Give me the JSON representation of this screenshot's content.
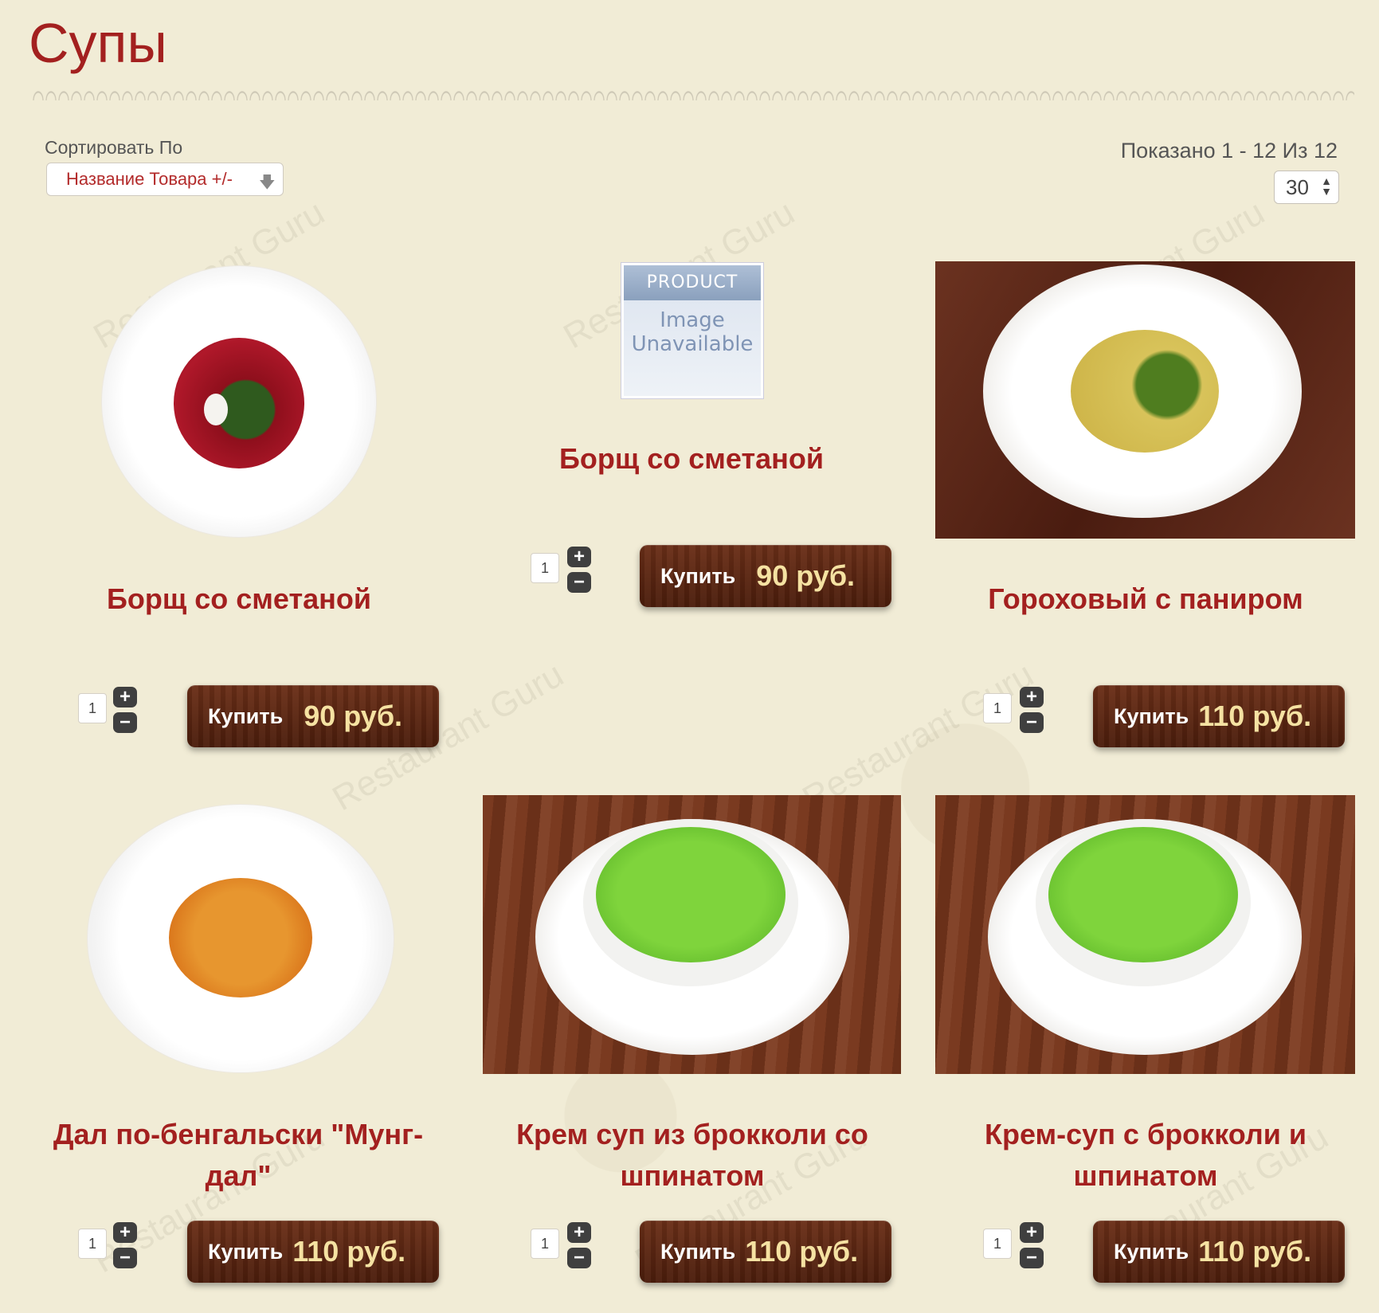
{
  "page": {
    "title": "Супы"
  },
  "toolbar": {
    "sort_label": "Сортировать По",
    "sort_value": "Название Товара +/-",
    "shown_text": "Показано 1 - 12 Из 12",
    "per_page": "30"
  },
  "products": [
    {
      "name": "Борщ со сметаной",
      "qty": "1",
      "buy_label": "Купить",
      "price": "90 руб.",
      "image": "plate-borscht"
    },
    {
      "name": "Борщ со сметаной",
      "qty": "1",
      "buy_label": "Купить",
      "price": "90 руб.",
      "image": "placeholder"
    },
    {
      "name": "Гороховый с паниром",
      "qty": "1",
      "buy_label": "Купить",
      "price": "110 руб.",
      "image": "plate-pea-soup"
    },
    {
      "name": "Дал по-бенгальски \"Мунг-дал\"",
      "qty": "1",
      "buy_label": "Купить",
      "price": "110 руб.",
      "image": "plate-dal"
    },
    {
      "name": "Крем суп из брокколи со шпинатом",
      "qty": "1",
      "buy_label": "Купить",
      "price": "110 руб.",
      "image": "bowl-broccoli"
    },
    {
      "name": "Крем-суп с брокколи и шпинатом",
      "qty": "1",
      "buy_label": "Купить",
      "price": "110 руб.",
      "image": "bowl-broccoli"
    }
  ],
  "placeholder": {
    "top": "PRODUCT",
    "line1": "Image",
    "line2": "Unavailable"
  },
  "watermark": "Restaurant Guru",
  "colors": {
    "accent": "#a3201f",
    "background": "#f1ecd6",
    "button": "#5a2512"
  }
}
